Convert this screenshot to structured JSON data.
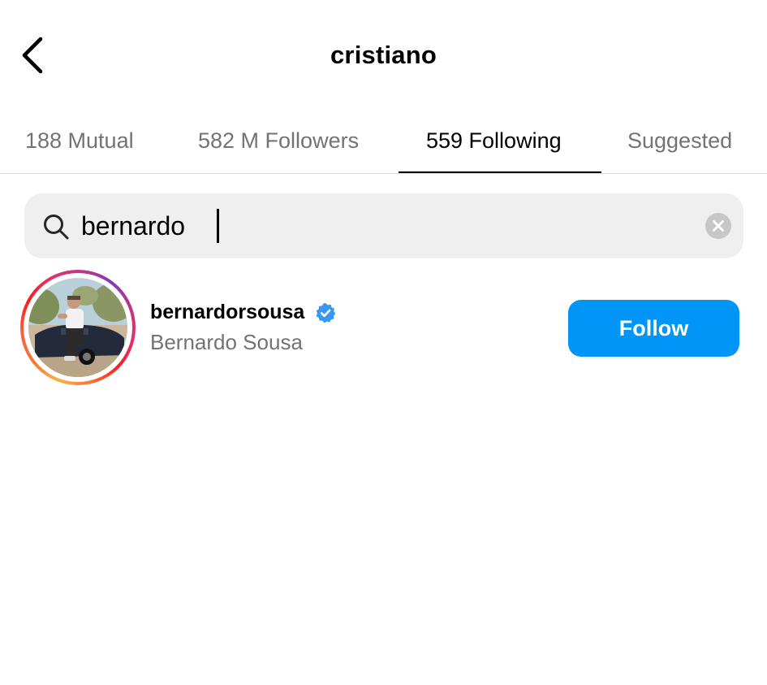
{
  "header": {
    "title": "cristiano",
    "back_icon": "chevron-left-icon"
  },
  "tabs": [
    {
      "label": "188 Mutual",
      "active": false
    },
    {
      "label": "582 M Followers",
      "active": false
    },
    {
      "label": "559 Following",
      "active": true
    },
    {
      "label": "Suggested",
      "active": false
    }
  ],
  "search": {
    "value": "bernardo",
    "placeholder": "Search",
    "search_icon": "search-icon",
    "clear_icon": "clear-icon"
  },
  "results": [
    {
      "username": "bernardorsousa",
      "full_name": "Bernardo Sousa",
      "verified": true,
      "has_story": true,
      "follow_label": "Follow"
    }
  ],
  "colors": {
    "accent": "#0095f6",
    "verified": "#3897f0",
    "secondary_text": "#737373",
    "search_bg": "#efefef"
  }
}
